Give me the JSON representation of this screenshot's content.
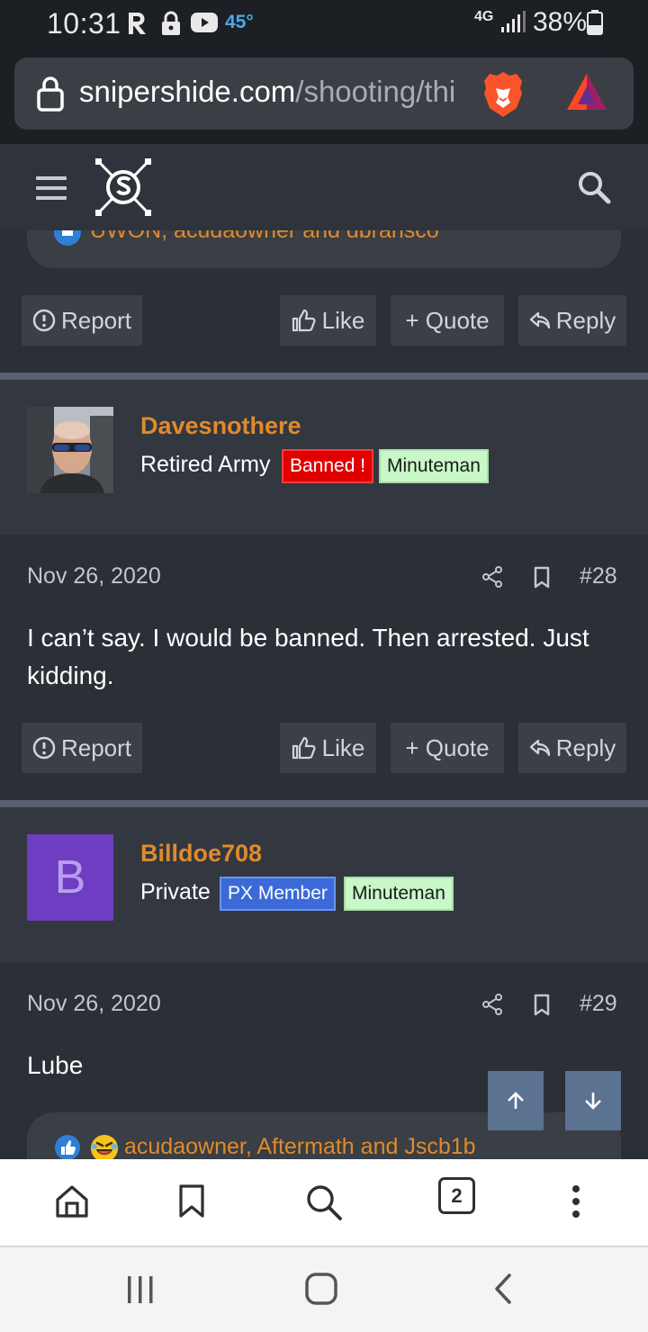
{
  "status_bar": {
    "time": "10:31",
    "temperature": "45°",
    "network": "4G",
    "battery": "38%"
  },
  "browser": {
    "url_host": "snipershide.com",
    "url_path": "/shooting/thi",
    "tab_count": "2"
  },
  "top_post": {
    "reactions_names": "UWON, acudaowner and dbransco"
  },
  "actions": {
    "report": "Report",
    "like": "Like",
    "quote": "+ Quote",
    "reply": "Reply"
  },
  "posts": [
    {
      "username": "Davesnothere",
      "user_title": "Retired Army",
      "badges": [
        "Banned !",
        "Minuteman"
      ],
      "date": "Nov 26, 2020",
      "post_number": "#28",
      "text": "I can’t say. I would be banned. Then arrested. Just kidding."
    },
    {
      "username": "Billdoe708",
      "avatar_letter": "B",
      "user_title": "Private",
      "badges": [
        "PX Member",
        "Minuteman"
      ],
      "date": "Nov 26, 2020",
      "post_number": "#29",
      "text": "Lube",
      "reactions_names": "acudaowner, Aftermath and Jscb1b"
    }
  ],
  "colors": {
    "accent_orange": "#e08a2b",
    "banned_red": "#e00000",
    "minuteman_green": "#c8f7c8",
    "px_blue": "#3b6ad8",
    "scroll_button": "#5b7290"
  }
}
